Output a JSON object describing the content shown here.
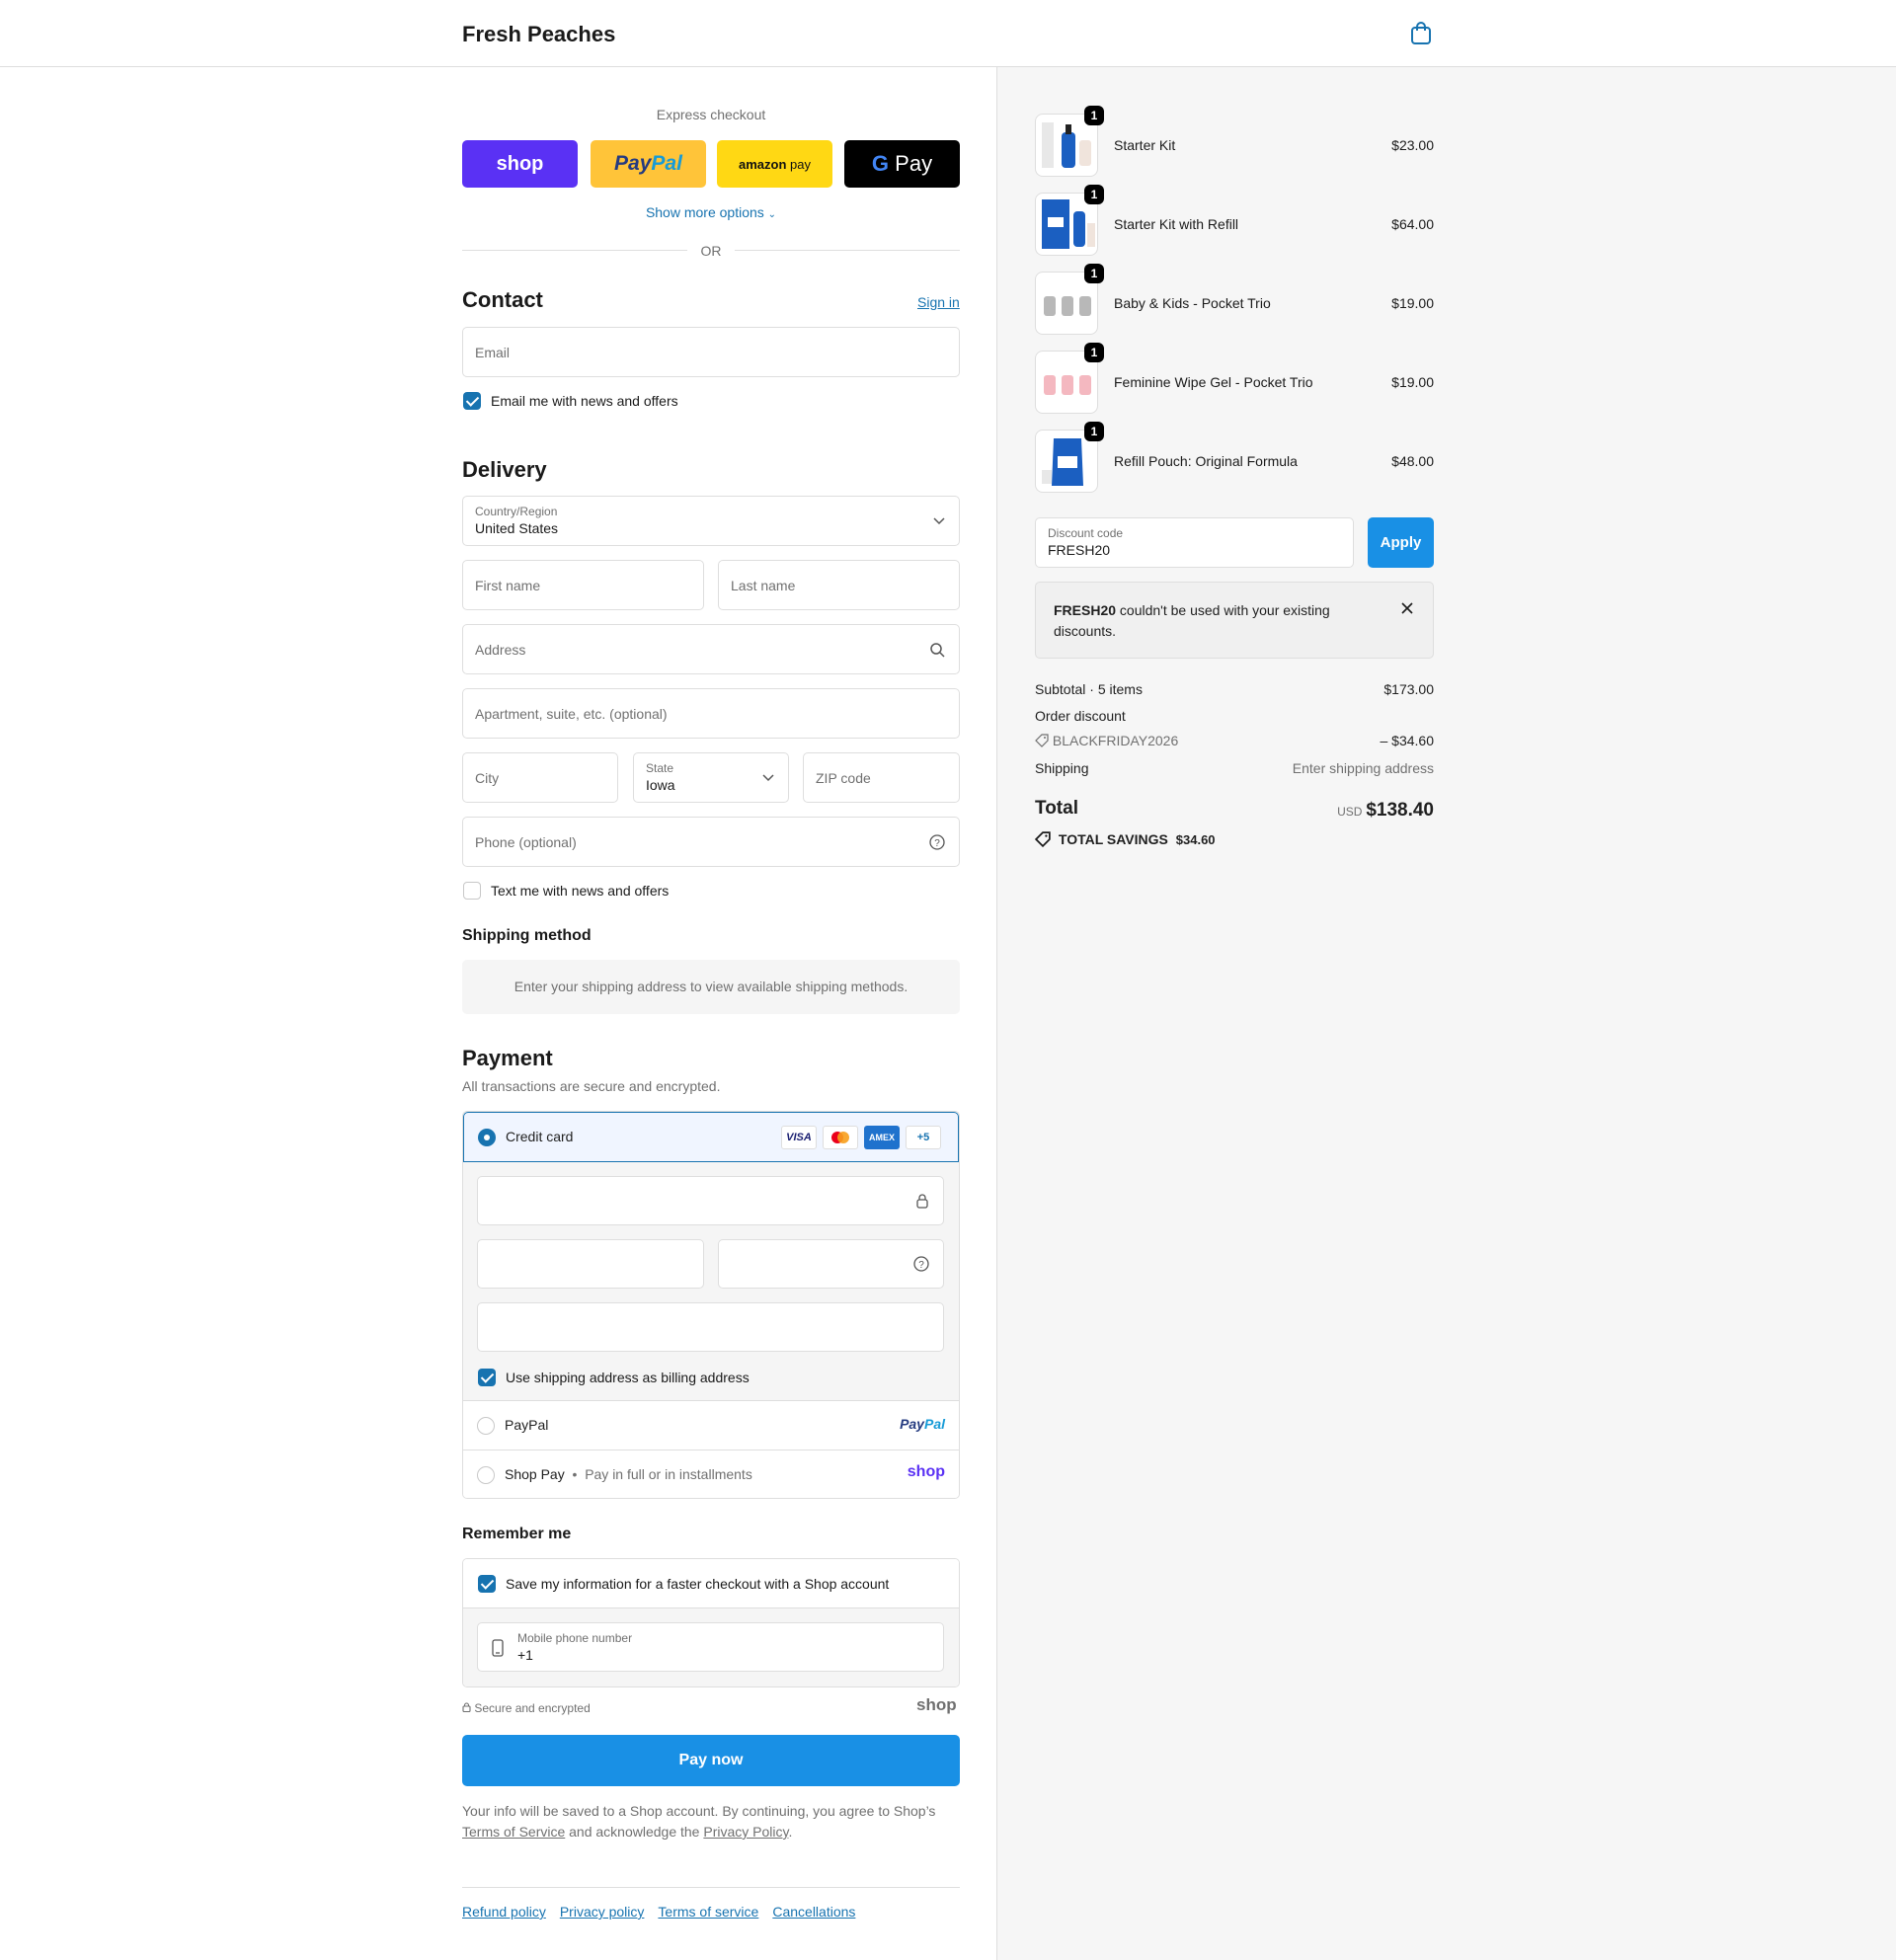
{
  "header": {
    "brand": "Fresh Peaches"
  },
  "express": {
    "title": "Express checkout",
    "buttons": {
      "shop": "shop",
      "paypal_pay": "Pay",
      "paypal_pal": "Pal",
      "amazon": "amazon",
      "amazon_pay": "pay",
      "gpay_g": "G",
      "gpay_pay": "Pay"
    },
    "show_more": "Show more options",
    "or": "OR"
  },
  "contact": {
    "title": "Contact",
    "sign_in": "Sign in",
    "email_placeholder": "Email",
    "news_label": "Email me with news and offers",
    "news_checked": true
  },
  "delivery": {
    "title": "Delivery",
    "country_label": "Country/Region",
    "country_value": "United States",
    "first_name": "First name",
    "last_name": "Last name",
    "address": "Address",
    "apartment": "Apartment, suite, etc. (optional)",
    "city": "City",
    "state_label": "State",
    "state_value": "Iowa",
    "zip": "ZIP code",
    "phone": "Phone (optional)",
    "text_label": "Text me with news and offers",
    "text_checked": false
  },
  "shipping_method": {
    "title": "Shipping method",
    "message": "Enter your shipping address to view available shipping methods."
  },
  "payment": {
    "title": "Payment",
    "subtitle": "All transactions are secure and encrypted.",
    "credit_card": "Credit card",
    "card_brands": [
      "VISA",
      "AMEX",
      "+5"
    ],
    "billing_label": "Use shipping address as billing address",
    "paypal": "PayPal",
    "paypal_logo_a": "Pay",
    "paypal_logo_b": "Pal",
    "shop_pay": "Shop Pay",
    "shop_pay_sub": "Pay in full or in installments",
    "shop_logo": "shop"
  },
  "remember": {
    "title": "Remember me",
    "save_label": "Save my information for a faster checkout with a Shop account",
    "phone_label": "Mobile phone number",
    "phone_value": "+1",
    "secure": "Secure and encrypted",
    "shop_logo": "shop"
  },
  "pay_now": "Pay now",
  "legal": {
    "text1": "Your info will be saved to a Shop account. By continuing, you agree to Shop’s",
    "terms": "Terms of Service",
    "text2": "and acknowledge the",
    "privacy": "Privacy Policy",
    "period": "."
  },
  "footer": [
    "Refund policy",
    "Privacy policy",
    "Terms of service",
    "Cancellations"
  ],
  "cart": {
    "items": [
      {
        "name": "Starter Kit",
        "price": "$23.00",
        "qty": "1"
      },
      {
        "name": "Starter Kit with Refill",
        "price": "$64.00",
        "qty": "1"
      },
      {
        "name": "Baby & Kids - Pocket Trio",
        "price": "$19.00",
        "qty": "1"
      },
      {
        "name": "Feminine Wipe Gel - Pocket Trio",
        "price": "$19.00",
        "qty": "1"
      },
      {
        "name": "Refill Pouch: Original Formula",
        "price": "$48.00",
        "qty": "1"
      }
    ],
    "discount_label": "Discount code",
    "discount_value": "FRESH20",
    "apply": "Apply",
    "notice_code": "FRESH20",
    "notice_text": "couldn't be used with your existing discounts.",
    "subtotal_label": "Subtotal · 5 items",
    "subtotal": "$173.00",
    "order_discount": "Order discount",
    "discount_code_applied": "BLACKFRIDAY2026",
    "discount_amount": "– $34.60",
    "shipping_label": "Shipping",
    "shipping_value": "Enter shipping address",
    "total_label": "Total",
    "currency": "USD",
    "total": "$138.40",
    "savings_label": "TOTAL SAVINGS",
    "savings": "$34.60"
  },
  "colors": {
    "accent": "#1990e5",
    "link": "#1773b0",
    "shop_purple": "#5a31f4",
    "paypal_yellow": "#ffc439",
    "amazon_yellow": "#ffd814"
  }
}
